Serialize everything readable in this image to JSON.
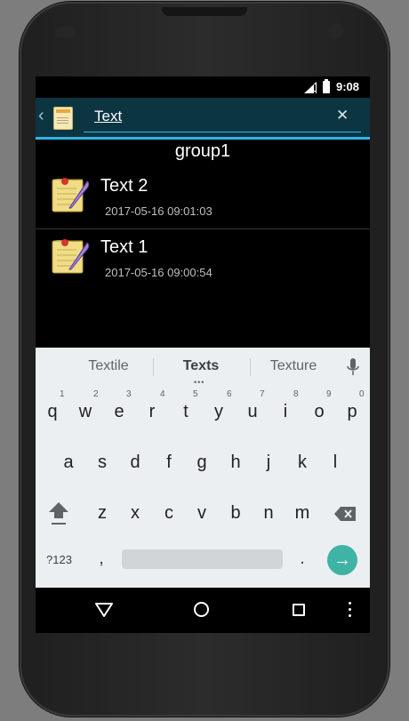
{
  "status_bar": {
    "time": "9:08"
  },
  "action_bar": {
    "back_icon": "chevron-left-icon",
    "app_icon": "notepad-icon",
    "search_value": "Text",
    "clear_icon": "close-icon"
  },
  "list": {
    "group_title": "group1",
    "items": [
      {
        "title": "Text 2",
        "date": "2017-05-16 09:01:03",
        "icon": "note-quill-icon"
      },
      {
        "title": "Text 1",
        "date": "2017-05-16 09:00:54",
        "icon": "note-quill-icon"
      }
    ]
  },
  "keyboard": {
    "suggestions": [
      "Textile",
      "Texts",
      "Texture"
    ],
    "selected_suggestion": "Texts",
    "suggestion_dots": "•••",
    "row1": [
      "q",
      "w",
      "e",
      "r",
      "t",
      "y",
      "u",
      "i",
      "o",
      "p"
    ],
    "row1_hints": [
      "1",
      "2",
      "3",
      "4",
      "5",
      "6",
      "7",
      "8",
      "9",
      "0"
    ],
    "row2": [
      "a",
      "s",
      "d",
      "f",
      "g",
      "h",
      "j",
      "k",
      "l"
    ],
    "row3": [
      "z",
      "x",
      "c",
      "v",
      "b",
      "n",
      "m"
    ],
    "symbols_label": "?123",
    "comma": ",",
    "period": ".",
    "enter_icon": "arrow-right-icon"
  },
  "colors": {
    "accent": "#33b5e5",
    "action_bar": "#0c3542",
    "enter_key": "#3fb4a4"
  }
}
